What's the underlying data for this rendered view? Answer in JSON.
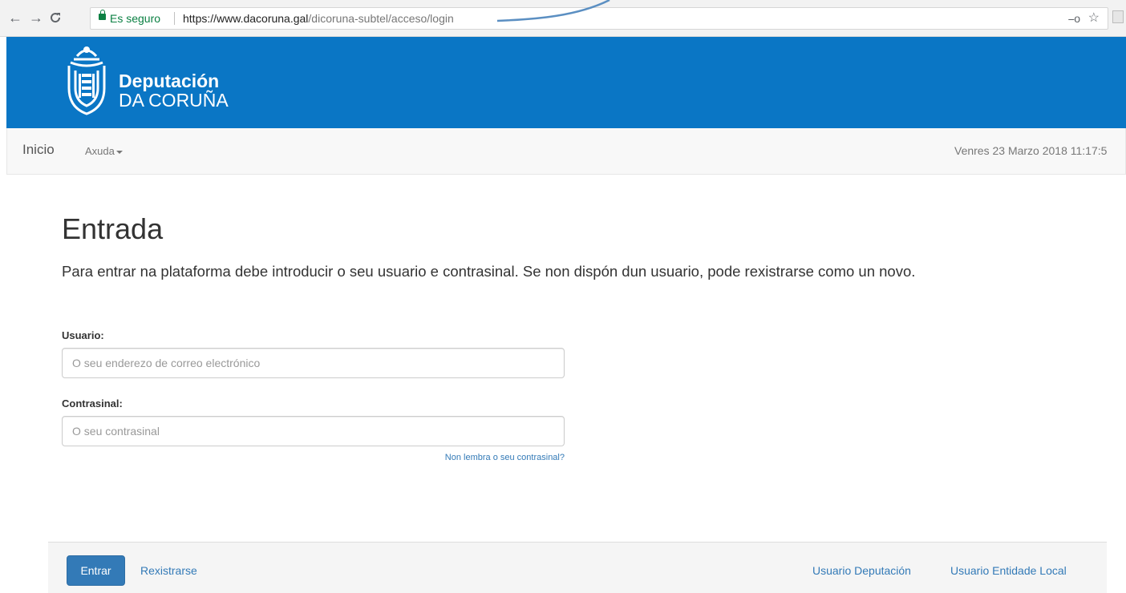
{
  "browser": {
    "secure_label": "Es seguro",
    "url_host": "https://www.dacoruna.gal",
    "url_path": "/dicoruna-subtel/acceso/login",
    "back_icon": "back-arrow-icon",
    "forward_icon": "forward-arrow-icon",
    "reload_icon": "reload-icon",
    "key_icon": "key-icon",
    "star_icon": "bookmark-star-icon"
  },
  "header": {
    "brand_line1": "Deputación",
    "brand_line2": "DA CORUÑA",
    "background_color": "#0a76c5"
  },
  "navbar": {
    "home": "Inicio",
    "help": "Axuda",
    "datetime": "Venres 23 Marzo 2018 11:17:5"
  },
  "main": {
    "title": "Entrada",
    "intro": "Para entrar na plataforma debe introducir o seu usuario e contrasinal. Se non dispón dun usuario, pode rexistrarse como un novo.",
    "user_label": "Usuario:",
    "user_placeholder": "O seu enderezo de correo electrónico",
    "user_value": "",
    "password_label": "Contrasinal:",
    "password_placeholder": "O seu contrasinal",
    "password_value": "",
    "forgot_link": "Non lembra o seu contrasinal?"
  },
  "footer": {
    "login_button": "Entrar",
    "register_link": "Rexistrarse",
    "deputacion_link": "Usuario Deputación",
    "entidade_link": "Usuario Entidade Local",
    "primary_color": "#337ab7"
  }
}
